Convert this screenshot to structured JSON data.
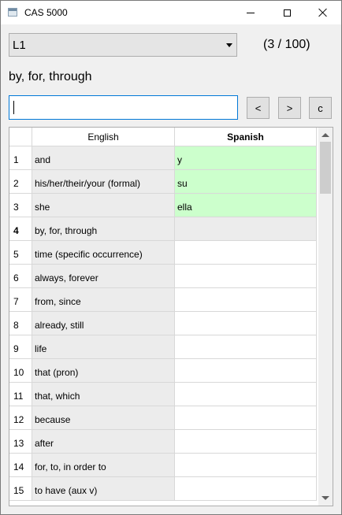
{
  "window": {
    "title": "CAS 5000"
  },
  "controls": {
    "list_select": "L1",
    "progress": "(3 / 100)",
    "prompt": "by, for, through",
    "answer_value": "",
    "prev_label": "<",
    "next_label": ">",
    "clear_label": "c"
  },
  "table": {
    "headers": [
      "English",
      "Spanish"
    ],
    "rows": [
      {
        "n": "1",
        "en": "and",
        "es": "y",
        "state": "correct"
      },
      {
        "n": "2",
        "en": "his/her/their/your (formal)",
        "es": "su",
        "state": "correct"
      },
      {
        "n": "3",
        "en": "she",
        "es": "ella",
        "state": "correct"
      },
      {
        "n": "4",
        "en": "by, for, through",
        "es": "",
        "state": "current"
      },
      {
        "n": "5",
        "en": "time (specific occurrence)",
        "es": "",
        "state": "pending"
      },
      {
        "n": "6",
        "en": "always, forever",
        "es": "",
        "state": "pending"
      },
      {
        "n": "7",
        "en": "from, since",
        "es": "",
        "state": "pending"
      },
      {
        "n": "8",
        "en": "already, still",
        "es": "",
        "state": "pending"
      },
      {
        "n": "9",
        "en": "life",
        "es": "",
        "state": "pending"
      },
      {
        "n": "10",
        "en": "that (pron)",
        "es": "",
        "state": "pending"
      },
      {
        "n": "11",
        "en": "that, which",
        "es": "",
        "state": "pending"
      },
      {
        "n": "12",
        "en": "because",
        "es": "",
        "state": "pending"
      },
      {
        "n": "13",
        "en": "after",
        "es": "",
        "state": "pending"
      },
      {
        "n": "14",
        "en": "for, to, in order to",
        "es": "",
        "state": "pending"
      },
      {
        "n": "15",
        "en": "to have (aux v)",
        "es": "",
        "state": "pending"
      }
    ]
  },
  "colors": {
    "correct": "#ccffcc",
    "current": "#ececec",
    "focus": "#0078d7"
  }
}
